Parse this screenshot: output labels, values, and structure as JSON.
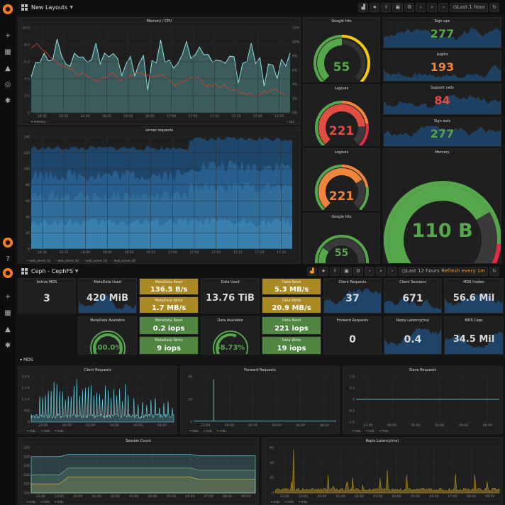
{
  "top": {
    "title": "New Layouts",
    "time_label": "Last 1 hour"
  },
  "bottom": {
    "title": "Ceph - CephFS",
    "time_label": "Last 12 hours",
    "refresh_label": "Refresh every 1m"
  },
  "panels": {
    "memcpu": {
      "title": "Memory / CPU",
      "yl": [
        "10 G",
        "8 G",
        "6 G",
        "4 G",
        "2 G",
        "0"
      ],
      "yr": [
        "12%",
        "10%",
        "8%",
        "6%",
        "4%",
        "2%",
        "0%"
      ],
      "x": [
        "16:30",
        "16:35",
        "16:40",
        "16:45",
        "16:50",
        "16:55",
        "17:00",
        "17:05",
        "17:10",
        "17:15",
        "17:20",
        "17:25"
      ],
      "legend_mem": "memory",
      "legend_cpu": "cpu"
    },
    "req": {
      "title": "server requests",
      "y": [
        "140",
        "120",
        "100",
        "80",
        "60",
        "40",
        "20",
        "0"
      ],
      "x": [
        "16:30",
        "16:35",
        "16:40",
        "16:45",
        "16:50",
        "16:55",
        "17:00",
        "17:05",
        "17:10",
        "17:15",
        "17:20",
        "17:25"
      ],
      "legend": [
        "web_server_01",
        "web_server_02",
        "web_server_03",
        "web_server_04"
      ]
    },
    "g1": {
      "title": "Google hits",
      "value": "55"
    },
    "g2": {
      "title": "Logouts",
      "value": "221"
    },
    "g3": {
      "title": "Logouts",
      "value": "221"
    },
    "g4": {
      "title": "Google hits",
      "value": "55"
    },
    "s1": {
      "title": "Sign ups",
      "value": "277"
    },
    "s2": {
      "title": "Logins",
      "value": "193"
    },
    "s3": {
      "title": "Support calls",
      "value": "84"
    },
    "s4": {
      "title": "Sign outs",
      "value": "277"
    },
    "mem": {
      "title": "Memory",
      "value": "110 B"
    },
    "c1": {
      "title": "Active MDS",
      "value": "3"
    },
    "c2": {
      "title": "MetaData Used",
      "value": "420 MiB"
    },
    "c3a": {
      "title": "MetaData Read",
      "value": "136.5 B/s"
    },
    "c3b": {
      "title": "MetaData Write",
      "value": "1.7 MB/s"
    },
    "c4": {
      "title": "Data Used",
      "value": "13.76 TiB"
    },
    "c5a": {
      "title": "Data Read",
      "value": "5.3 MB/s"
    },
    "c5b": {
      "title": "Data Write",
      "value": "20.9 MB/s"
    },
    "c6": {
      "title": "Client Requests",
      "value": "37"
    },
    "c7": {
      "title": "Client Sessions",
      "value": "671"
    },
    "c8": {
      "title": "MDS Inodes",
      "value": "56.6 Mil"
    },
    "d1": {
      "title": "MetaData Available",
      "value": "100.0%"
    },
    "d2a": {
      "title": "MetaData Read",
      "value": "0.2 iops"
    },
    "d2b": {
      "title": "MetaData Write",
      "value": "9 iops"
    },
    "d3": {
      "title": "Data Available",
      "value": "58.73%"
    },
    "d4a": {
      "title": "Data Read",
      "value": "221 iops"
    },
    "d4b": {
      "title": "Data Write",
      "value": "19 iops"
    },
    "d5": {
      "title": "Forward Requests",
      "value": "0"
    },
    "d6": {
      "title": "Reply Latency(ms)",
      "value": "0.4"
    },
    "d7": {
      "title": "MDS Caps",
      "value": "34.5 Mil"
    },
    "row": "MDS",
    "e1": {
      "title": "Client Requests",
      "y": [
        "2.0 K",
        "1.5 K",
        "1.0 K",
        "500",
        "0"
      ],
      "x": [
        "22:00",
        "00:00",
        "02:00",
        "04:00",
        "06:00",
        "08:00"
      ],
      "legend": [
        "mds.",
        "mds.",
        "mds."
      ]
    },
    "e2": {
      "title": "Forward Requests",
      "y": [
        "40",
        "20",
        "0"
      ],
      "x": [
        "22:00",
        "00:00",
        "02:00",
        "04:00",
        "06:00",
        "08:00"
      ],
      "legend": [
        "mds.",
        "mds.",
        "mds."
      ]
    },
    "e3": {
      "title": "Slave Requests",
      "y": [
        "1.0",
        "0.5",
        "0",
        "-0.5",
        "-1.0"
      ],
      "x": [
        "22:00",
        "00:00",
        "02:00",
        "04:00",
        "06:00",
        "08:00"
      ],
      "legend": [
        "mds.",
        "mds.",
        "mds."
      ]
    },
    "f1": {
      "title": "Session Count",
      "y": [
        "230",
        "228",
        "226",
        "224",
        "222",
        "220"
      ],
      "x": [
        "22:00",
        "23:00",
        "00:00",
        "01:00",
        "02:00",
        "03:00",
        "04:00",
        "05:00",
        "06:00",
        "07:00",
        "08:00",
        "09:00"
      ],
      "legend": [
        "mds.",
        "mds.",
        "mds."
      ]
    },
    "f2": {
      "title": "Reply Latency(ms)",
      "y": [
        "60",
        "40",
        "20",
        "0"
      ],
      "x": [
        "22:00",
        "23:00",
        "00:00",
        "01:00",
        "02:00",
        "03:00",
        "04:00",
        "05:00",
        "06:00",
        "07:00",
        "08:00",
        "09:00"
      ],
      "legend": [
        "mds.",
        "mds.",
        "mds."
      ]
    }
  }
}
